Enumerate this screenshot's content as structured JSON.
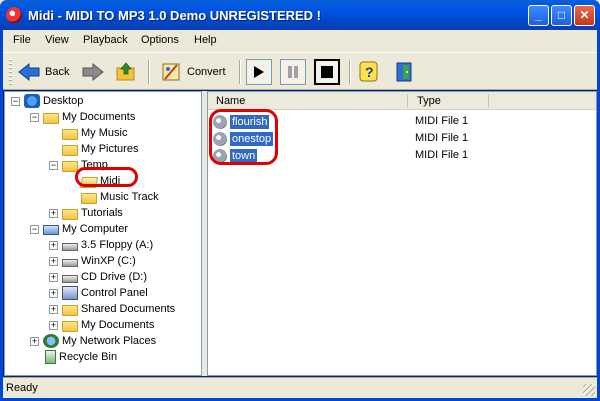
{
  "window": {
    "title": "Midi - MIDI TO MP3 1.0 Demo UNREGISTERED !",
    "minimize": "_",
    "maximize": "□",
    "close": "✕"
  },
  "menu": [
    "File",
    "View",
    "Playback",
    "Options",
    "Help"
  ],
  "toolbar": {
    "back_label": "Back",
    "convert_label": "Convert"
  },
  "tree": [
    {
      "label": "Desktop",
      "icon": "desktop-icon",
      "expander": "−"
    },
    {
      "label": "My Documents",
      "icon": "folder-icon",
      "expander": "−"
    },
    {
      "label": "My Music",
      "icon": "music-folder-icon",
      "expander": ""
    },
    {
      "label": "My Pictures",
      "icon": "pictures-folder-icon",
      "expander": ""
    },
    {
      "label": "Temp",
      "icon": "folder-icon",
      "expander": "−"
    },
    {
      "label": "Midi",
      "icon": "folder-open-icon",
      "expander": ""
    },
    {
      "label": "Music Track",
      "icon": "folder-icon",
      "expander": ""
    },
    {
      "label": "Tutorials",
      "icon": "folder-icon",
      "expander": "+"
    },
    {
      "label": "My Computer",
      "icon": "computer-icon",
      "expander": "−"
    },
    {
      "label": "3.5 Floppy (A:)",
      "icon": "floppy-icon",
      "expander": "+"
    },
    {
      "label": "WinXP (C:)",
      "icon": "hard-drive-icon",
      "expander": "+"
    },
    {
      "label": "CD Drive (D:)",
      "icon": "cd-drive-icon",
      "expander": "+"
    },
    {
      "label": "Control Panel",
      "icon": "control-panel-icon",
      "expander": "+"
    },
    {
      "label": "Shared Documents",
      "icon": "folder-icon",
      "expander": "+"
    },
    {
      "label": "My Documents",
      "icon": "folder-icon",
      "expander": "+"
    },
    {
      "label": "My Network Places",
      "icon": "network-icon",
      "expander": "+"
    },
    {
      "label": "Recycle Bin",
      "icon": "recycle-bin-icon",
      "expander": ""
    }
  ],
  "list": {
    "columns": [
      "Name",
      "Type"
    ],
    "rows": [
      {
        "name": "flourish",
        "type": "MIDI File 1"
      },
      {
        "name": "onestop",
        "type": "MIDI File 1"
      },
      {
        "name": "town",
        "type": "MIDI File 1"
      }
    ]
  },
  "status": {
    "text": "Ready"
  },
  "colors": {
    "titlebar": "#0055E5",
    "selection": "#316AC5",
    "annotation": "#E00000"
  }
}
